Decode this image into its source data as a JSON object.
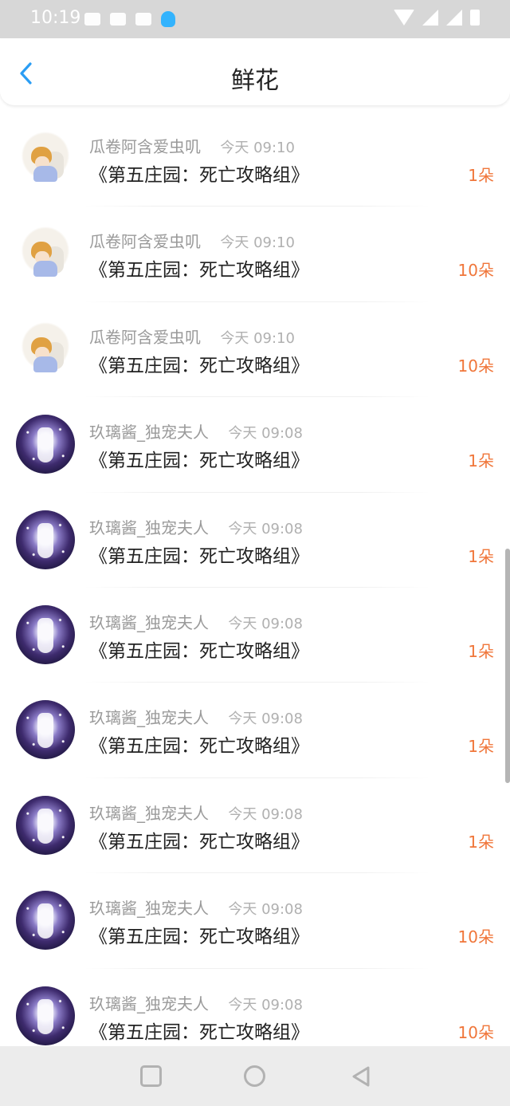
{
  "status_bar": {
    "time": "10:19"
  },
  "header": {
    "title": "鲜花"
  },
  "list": {
    "items": [
      {
        "name": "瓜卷阿含爱虫叽",
        "time": "今天 09:10",
        "work": "《第五庄园：死亡攻略组》",
        "count": "1朵",
        "avatar": "chibi-avatar"
      },
      {
        "name": "瓜卷阿含爱虫叽",
        "time": "今天 09:10",
        "work": "《第五庄园：死亡攻略组》",
        "count": "10朵",
        "avatar": "chibi-avatar"
      },
      {
        "name": "瓜卷阿含爱虫叽",
        "time": "今天 09:10",
        "work": "《第五庄园：死亡攻略组》",
        "count": "10朵",
        "avatar": "chibi-avatar"
      },
      {
        "name": "玖璃酱_独宠夫人",
        "time": "今天 09:08",
        "work": "《第五庄园：死亡攻略组》",
        "count": "1朵",
        "avatar": "night-avatar"
      },
      {
        "name": "玖璃酱_独宠夫人",
        "time": "今天 09:08",
        "work": "《第五庄园：死亡攻略组》",
        "count": "1朵",
        "avatar": "night-avatar"
      },
      {
        "name": "玖璃酱_独宠夫人",
        "time": "今天 09:08",
        "work": "《第五庄园：死亡攻略组》",
        "count": "1朵",
        "avatar": "night-avatar"
      },
      {
        "name": "玖璃酱_独宠夫人",
        "time": "今天 09:08",
        "work": "《第五庄园：死亡攻略组》",
        "count": "1朵",
        "avatar": "night-avatar"
      },
      {
        "name": "玖璃酱_独宠夫人",
        "time": "今天 09:08",
        "work": "《第五庄园：死亡攻略组》",
        "count": "1朵",
        "avatar": "night-avatar"
      },
      {
        "name": "玖璃酱_独宠夫人",
        "time": "今天 09:08",
        "work": "《第五庄园：死亡攻略组》",
        "count": "10朵",
        "avatar": "night-avatar"
      },
      {
        "name": "玖璃酱_独宠夫人",
        "time": "今天 09:08",
        "work": "《第五庄园：死亡攻略组》",
        "count": "10朵",
        "avatar": "night-avatar"
      }
    ]
  },
  "colors": {
    "accent": "#2a9df4",
    "count": "#f0763a",
    "name": "#9a9a9a"
  },
  "icons": {
    "back": "back-arrow-icon",
    "nav_recent": "square-icon",
    "nav_home": "circle-icon",
    "nav_back": "triangle-back-icon"
  }
}
